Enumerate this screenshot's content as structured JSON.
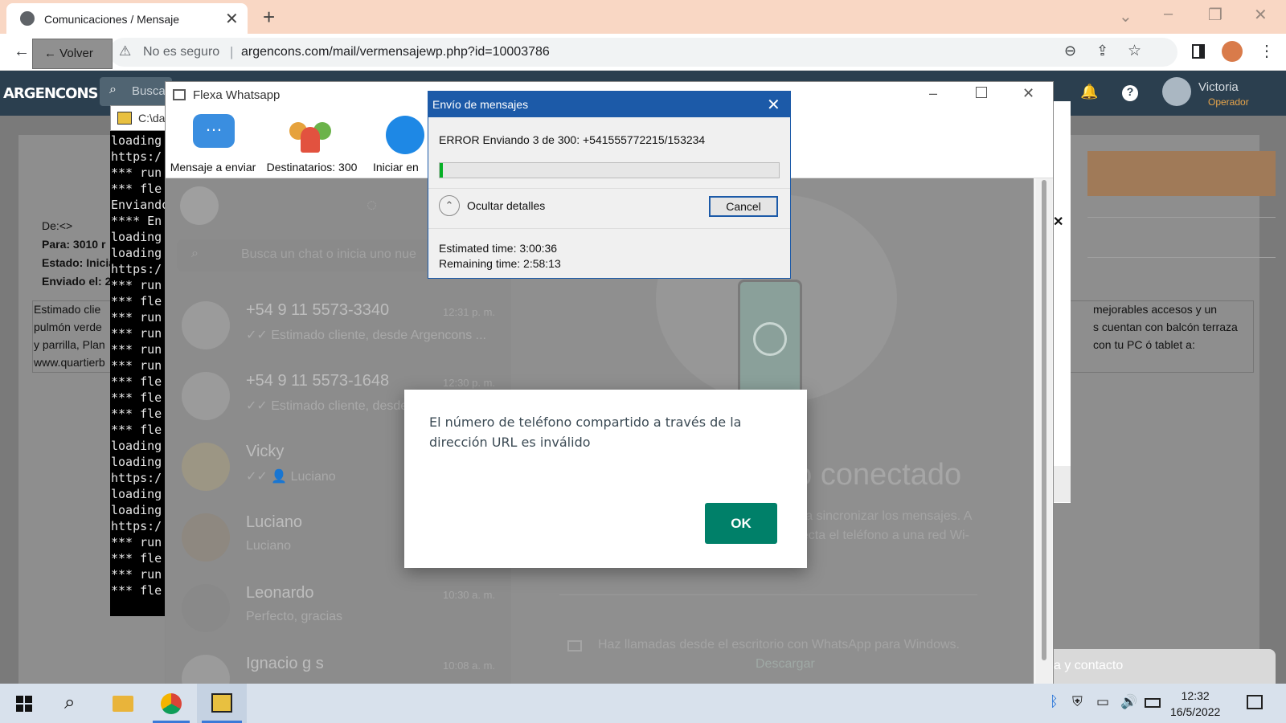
{
  "browser": {
    "tab_title": "Comunicaciones / Mensaje",
    "tab_close": "✕",
    "new_tab": "+",
    "security_label": "No es seguro",
    "url": "argencons.com/mail/vermensajewp.php?id=10003786"
  },
  "webapp": {
    "logo": "ARGENCONS",
    "search_placeholder": "Busca",
    "user_name": "Victoria",
    "user_role": "Operador",
    "back_label": "Volver",
    "meta_de": "De:<>",
    "meta_para": "Para: 3010 r",
    "meta_estado": "Estado: Inicia",
    "meta_enviado": "Enviado el: 2",
    "body_left": [
      "Estimado clie",
      "pulmón verde",
      "y parrilla, Plan",
      "www.quartierb"
    ],
    "body_right": [
      "mejorables accesos y un",
      "s cuentan con balcón terraza",
      "con tu PC ó tablet a:"
    ],
    "close_x": "✕",
    "contact_label": "a y contacto"
  },
  "cmd": {
    "title": "C:\\da",
    "lines": [
      "loading",
      "https:/",
      "*** run",
      "*** fle",
      "Enviando",
      "**** En",
      "loading",
      "loading",
      "https:/",
      "*** run",
      "*** fle",
      "*** run",
      "*** run",
      "*** run",
      "*** run",
      "*** fle",
      "*** fle",
      "*** fle",
      "*** fle",
      "loading",
      "loading",
      "https:/",
      "loading",
      "loading",
      "https:/",
      "*** run",
      "*** fle",
      "*** run",
      "*** fle"
    ]
  },
  "flexa": {
    "title": "Flexa Whatsapp",
    "btn_message": "Mensaje a enviar",
    "btn_recipients": "Destinatarios: 300",
    "btn_start": "Iniciar en"
  },
  "whatsapp": {
    "search_placeholder": "Busca un chat o inicia uno nue",
    "chats": [
      {
        "name": "+54 9 11 5573-3340",
        "time": "12:31 p. m.",
        "msg": "✓✓ Estimado cliente, desde Argencons ..."
      },
      {
        "name": "+54 9 11 5573-1648",
        "time": "12:30 p. m.",
        "msg": "✓✓ Estimado cliente, desde"
      },
      {
        "name": "Vicky",
        "time": "",
        "msg": "✓✓ 👤 Luciano"
      },
      {
        "name": "Luciano",
        "time": "",
        "msg": "Luciano"
      },
      {
        "name": "Leonardo",
        "time": "10:30 a. m.",
        "msg": "Perfecto, gracias"
      },
      {
        "name": "Ignacio g s",
        "time": "10:08 a. m.",
        "msg": ""
      }
    ],
    "not_connected": "no conectado",
    "sync_line1": "ara sincronizar los mensajes. A",
    "sync_line2": "necta el teléfono a una red Wi-",
    "calls_text": "Haz llamadas desde el escritorio con WhatsApp para Windows.",
    "download_link": "Descargar"
  },
  "progress_dialog": {
    "title": "Envío de mensajes",
    "error_text": "ERROR Enviando 3 de 300: +541555772215/153234",
    "progress_fraction": 0.01,
    "details_label": "Ocultar detalles",
    "cancel_label": "Cancel",
    "estimated": "Estimated time: 3:00:36",
    "remaining": "Remaining time: 2:58:13"
  },
  "modal": {
    "message": "El número de teléfono compartido a través de la dirección URL es inválido",
    "ok_label": "OK"
  },
  "taskbar": {
    "time": "12:32",
    "date": "16/5/2022"
  },
  "colors": {
    "dialog_blue": "#1c5aa8",
    "progress_green": "#06b025",
    "whatsapp_green": "#008069",
    "browser_tab_bg": "#f9d7c4"
  }
}
